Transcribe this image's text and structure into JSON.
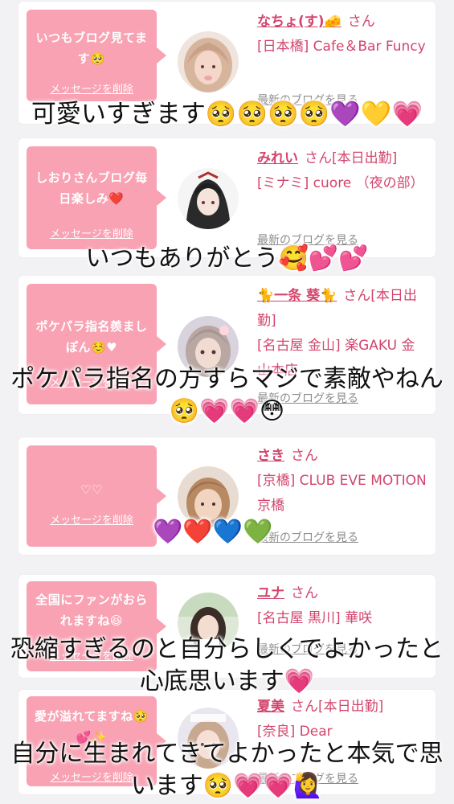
{
  "delete_label": "メッセージを削除",
  "latest_label": "最新のブログを見る",
  "san_label": "さん",
  "cards": [
    {
      "message": "いつもブログ見てます🥺",
      "name": "なちょ(す)🧀",
      "attendance": "",
      "shop": "[日本橋] Cafe＆Bar Funcy"
    },
    {
      "message": "しおりさんブログ毎日楽しみ❤️",
      "name": "みれい",
      "attendance": "[本日出勤]",
      "shop": "[ミナミ] cuore （夜の部）"
    },
    {
      "message": "ポケパラ指名羨ましぽん☺️♥",
      "name": "🐈一条 葵🐈",
      "attendance": "[本日出勤]",
      "shop": "[名古屋 金山] 楽GAKU 金山本店"
    },
    {
      "message": "♡♡",
      "name": "さき",
      "attendance": "",
      "shop": "[京橋] CLUB EVE MOTION 京橋"
    },
    {
      "message": "全国にファンがおられますね😆",
      "name": "ユナ",
      "attendance": "",
      "shop": "[名古屋 黒川] 華咲"
    },
    {
      "message": "愛が溢れてますね🥺💕✨",
      "name": "夏美",
      "attendance": "[本日出勤]",
      "shop": "[奈良] Dear"
    }
  ],
  "overlays": [
    "可愛いすぎます🥺🥺🥺🥺💜💛💗",
    "いつもありがとう🥰💕💕",
    "ポケパラ指名の方すらマジで素敵やねん🥺💗💗😳",
    "💜❤️💙💚",
    "恐縮すぎるのと自分らしくでよかったと心底思います💗",
    "自分に生まれてきてよかったと本気で思います🥺💗💗🙋‍♀️"
  ],
  "colors": {
    "bubble": "#f8a2b3",
    "accent": "#d3456d",
    "background": "#f2f2f4"
  }
}
